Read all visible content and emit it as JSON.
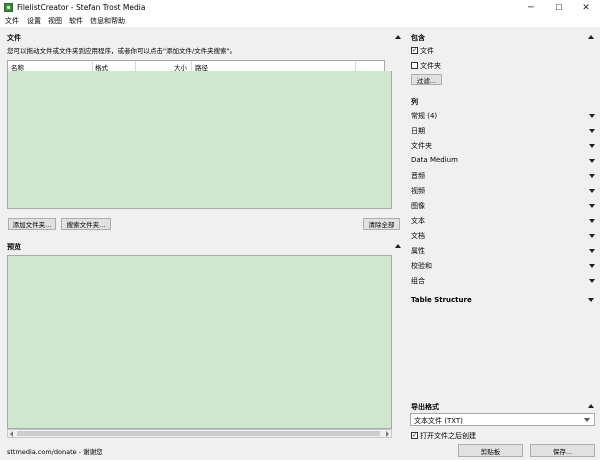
{
  "window": {
    "title": "FilelistCreator - Stefan Trost Media",
    "minimize": "─",
    "maximize": "☐",
    "close": "✕"
  },
  "menu": [
    "文件",
    "设置",
    "视图",
    "软件",
    "信息和帮助"
  ],
  "files_panel": {
    "title": "文件",
    "hint": "您可以拖动文件或文件夹到应用程序，或者你可以点击\"添加文件/文件夹搜索\"。",
    "columns": [
      "名称",
      "格式",
      "大小",
      "路径"
    ],
    "add_button": "添加文件夹...",
    "search_button": "搜索文件夹...",
    "clear_button": "清除全部"
  },
  "preview_panel": {
    "title": "预览"
  },
  "include": {
    "title": "包含",
    "files_label": "文件",
    "files_checked": true,
    "folders_label": "文件夹",
    "folders_checked": false,
    "filter_button": "过滤..."
  },
  "columns_section": {
    "title": "列",
    "items": [
      "常规 (4)",
      "日期",
      "文件夹",
      "Data Medium",
      "音频",
      "视频",
      "图像",
      "文本",
      "文档",
      "属性",
      "校验和",
      "组合"
    ]
  },
  "table_structure": {
    "title": "Table Structure"
  },
  "export": {
    "title": "导出格式",
    "format": "文本文件 (TXT)",
    "open_after_label": "打开文件之后创建",
    "open_after_checked": true,
    "clipboard_button": "剪贴板",
    "save_button": "保存..."
  },
  "status": {
    "text": "sttmedia.com/donate - 谢谢您"
  },
  "colors": {
    "list_background": "#cfe7cf",
    "window_background": "#f0f0f0"
  }
}
